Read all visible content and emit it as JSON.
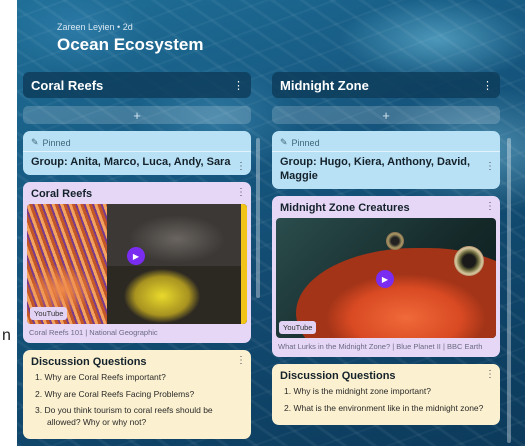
{
  "left_strip": {
    "letter": "n"
  },
  "board": {
    "author": "Zareen Leyien • 2d",
    "title": "Ocean Ecosystem"
  },
  "columns": [
    {
      "title": "Coral Reefs",
      "add_label": "+",
      "pinned_label": "Pinned",
      "group_title": "Group: Anita, Marco, Luca, Andy, Sara",
      "media_card": {
        "title": "Coral Reefs",
        "source_badge": "YouTube",
        "caption": "Coral Reefs 101 | National Geographic"
      },
      "questions_card": {
        "title": "Discussion Questions",
        "items": [
          "1. Why are Coral Reefs important?",
          "2. Why are Coral Reefs Facing Problems?",
          "3. Do you think tourism to coral reefs should be allowed? Why or why not?"
        ]
      }
    },
    {
      "title": "Midnight Zone",
      "add_label": "+",
      "pinned_label": "Pinned",
      "group_title": "Group: Hugo, Kiera, Anthony, David, Maggie",
      "media_card": {
        "title": "Midnight Zone Creatures",
        "source_badge": "YouTube",
        "caption": "What Lurks in the Midnight Zone? | Blue Planet II | BBC Earth"
      },
      "questions_card": {
        "title": "Discussion Questions",
        "items": [
          "1. Why is the midnight zone important?",
          "2. What is the environment like in the midnight zone?"
        ]
      }
    }
  ],
  "icons": {
    "kebab": "⋮",
    "pin": "📌",
    "play": "▶"
  }
}
